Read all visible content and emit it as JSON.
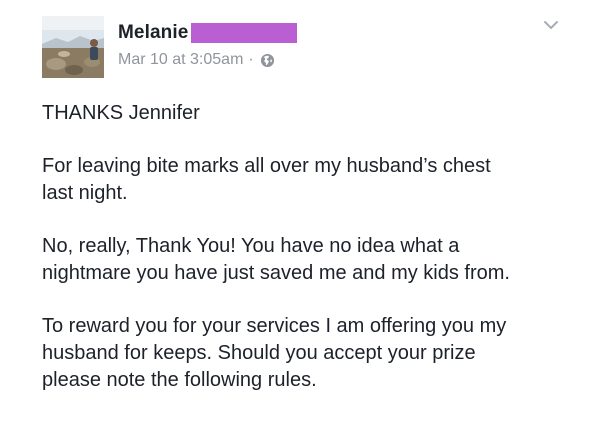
{
  "post": {
    "author": {
      "name": "Melanie",
      "name_redaction_color": "#b95fd3"
    },
    "timestamp": "Mar 10 at 3:05am",
    "separator": "·",
    "privacy_icon": "globe-icon",
    "menu_icon": "chevron-down-icon",
    "paragraphs": [
      "THANKS Jennifer",
      "For leaving bite marks all over my husband’s chest\nlast night.",
      "No, really, Thank You! You have no idea what a\nnightmare you have just saved me and my kids from.",
      "To reward you for your services I am offering you my\nhusband for keeps. Should you accept your prize\nplease note the following rules."
    ]
  }
}
